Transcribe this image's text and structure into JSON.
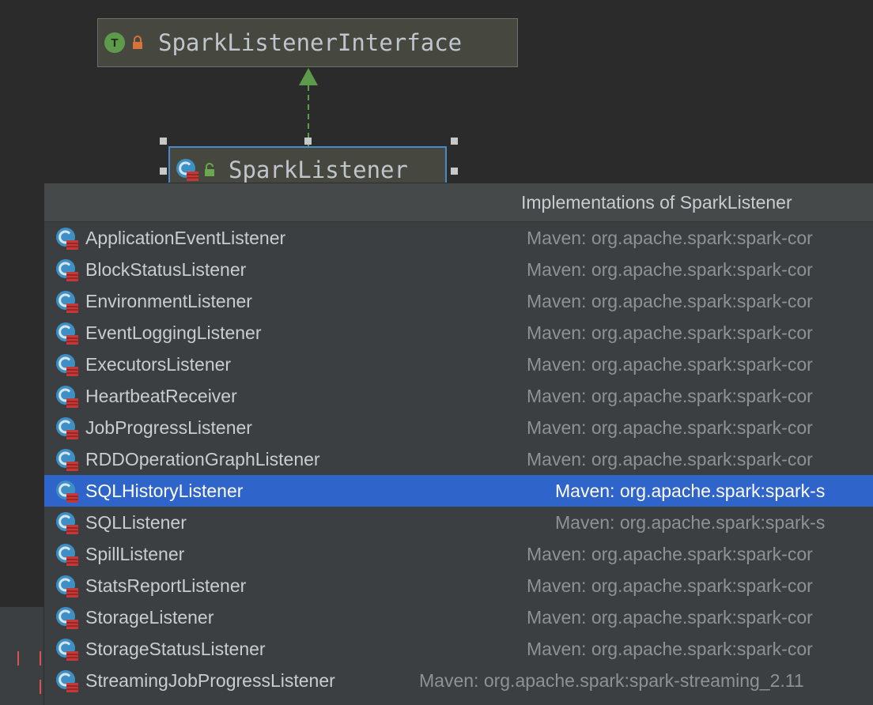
{
  "diagram": {
    "interface_node": {
      "badge": "T",
      "name": "SparkListenerInterface"
    },
    "class_node": {
      "name": "SparkListener"
    }
  },
  "popup": {
    "title": "Implementations of SparkListener",
    "selected_index": 8,
    "items": [
      {
        "name": "ApplicationEventListener",
        "source": "Maven: org.apache.spark:spark-cor"
      },
      {
        "name": "BlockStatusListener",
        "source": "Maven: org.apache.spark:spark-cor"
      },
      {
        "name": "EnvironmentListener",
        "source": "Maven: org.apache.spark:spark-cor"
      },
      {
        "name": "EventLoggingListener",
        "source": "Maven: org.apache.spark:spark-cor"
      },
      {
        "name": "ExecutorsListener",
        "source": "Maven: org.apache.spark:spark-cor"
      },
      {
        "name": "HeartbeatReceiver",
        "source": "Maven: org.apache.spark:spark-cor"
      },
      {
        "name": "JobProgressListener",
        "source": "Maven: org.apache.spark:spark-cor"
      },
      {
        "name": "RDDOperationGraphListener",
        "source": "Maven: org.apache.spark:spark-cor"
      },
      {
        "name": "SQLHistoryListener",
        "source": "Maven: org.apache.spark:spark-s"
      },
      {
        "name": "SQLListener",
        "source": "Maven: org.apache.spark:spark-s"
      },
      {
        "name": "SpillListener",
        "source": "Maven: org.apache.spark:spark-cor"
      },
      {
        "name": "StatsReportListener",
        "source": "Maven: org.apache.spark:spark-cor"
      },
      {
        "name": "StorageListener",
        "source": "Maven: org.apache.spark:spark-cor"
      },
      {
        "name": "StorageStatusListener",
        "source": "Maven: org.apache.spark:spark-cor"
      },
      {
        "name": "StreamingJobProgressListener",
        "source": "Maven: org.apache.spark:spark-streaming_2.11"
      }
    ]
  },
  "colors": {
    "background": "#2b2b2b",
    "popup_bg": "#3c3f41",
    "selection": "#2f65ca",
    "node_fill": "#46473f",
    "node_selected_border": "#4a88c7",
    "edge": "#5d9b4a"
  }
}
